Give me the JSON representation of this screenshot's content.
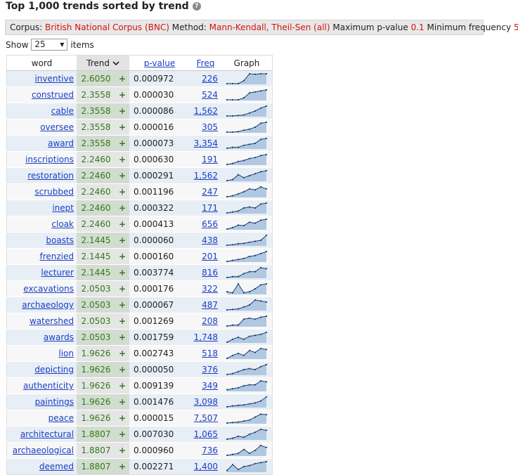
{
  "title": "Top 1,000 trends sorted by trend",
  "info": {
    "corpus_label": "Corpus:",
    "corpus_value": "British National Corpus (BNC)",
    "method_label": "Method:",
    "method_value": "Mann-Kendall, Theil-Sen (all)",
    "pvalue_label": "Maximum p-value",
    "pvalue_value": "0.1",
    "freq_label": "Minimum frequency",
    "freq_value": "5"
  },
  "show": {
    "label": "Show",
    "value": "25",
    "suffix": "items"
  },
  "columns": {
    "word": "word",
    "trend": "Trend",
    "pvalue": "p-value",
    "freq": "Freq",
    "graph": "Graph"
  },
  "colors": {
    "link": "#1a3ec5",
    "trend": "#2e7d1a",
    "accent": "#d21212",
    "graph_fill": "#b0c8e2",
    "graph_line": "#1d3f70"
  },
  "rows": [
    {
      "word": "inventive",
      "trend": "2.6050",
      "sign": "+",
      "pvalue": "0.000972",
      "freq": "226",
      "graph": [
        0,
        0,
        0,
        0.3,
        1,
        0.95,
        1,
        1
      ]
    },
    {
      "word": "construed",
      "trend": "2.3558",
      "sign": "+",
      "pvalue": "0.000030",
      "freq": "524",
      "graph": [
        0,
        0,
        0,
        0.2,
        0.7,
        0.8,
        0.9,
        1
      ]
    },
    {
      "word": "cable",
      "trend": "2.3558",
      "sign": "+",
      "pvalue": "0.000086",
      "freq": "1,562",
      "graph": [
        0,
        0,
        0.05,
        0.1,
        0.3,
        0.5,
        0.8,
        1
      ]
    },
    {
      "word": "oversee",
      "trend": "2.3558",
      "sign": "+",
      "pvalue": "0.000016",
      "freq": "305",
      "graph": [
        0,
        0,
        0.05,
        0.2,
        0.3,
        0.5,
        0.9,
        1
      ]
    },
    {
      "word": "award",
      "trend": "2.3558",
      "sign": "+",
      "pvalue": "0.000073",
      "freq": "3,354",
      "graph": [
        0,
        0.1,
        0.1,
        0.3,
        0.4,
        0.5,
        0.9,
        1
      ]
    },
    {
      "word": "inscriptions",
      "trend": "2.2460",
      "sign": "+",
      "pvalue": "0.000630",
      "freq": "191",
      "graph": [
        0,
        0.1,
        0.3,
        0.4,
        0.6,
        0.7,
        0.9,
        1
      ]
    },
    {
      "word": "restoration",
      "trend": "2.2460",
      "sign": "+",
      "pvalue": "0.000291",
      "freq": "1,562",
      "graph": [
        0,
        0.1,
        0.6,
        0.3,
        0.5,
        0.7,
        0.9,
        1
      ]
    },
    {
      "word": "scrubbed",
      "trend": "2.2460",
      "sign": "+",
      "pvalue": "0.001196",
      "freq": "247",
      "graph": [
        0,
        0.1,
        0.3,
        0.5,
        0.8,
        0.7,
        1,
        0.8
      ]
    },
    {
      "word": "inept",
      "trend": "2.2460",
      "sign": "+",
      "pvalue": "0.000322",
      "freq": "171",
      "graph": [
        0,
        0.1,
        0.2,
        0.5,
        0.6,
        0.5,
        0.9,
        1
      ]
    },
    {
      "word": "cloak",
      "trend": "2.2460",
      "sign": "+",
      "pvalue": "0.000413",
      "freq": "656",
      "graph": [
        0,
        0.15,
        0.4,
        0.35,
        0.7,
        0.6,
        0.9,
        1
      ]
    },
    {
      "word": "boasts",
      "trend": "2.1445",
      "sign": "+",
      "pvalue": "0.000060",
      "freq": "438",
      "graph": [
        0,
        0.05,
        0.15,
        0.2,
        0.3,
        0.4,
        0.5,
        1
      ]
    },
    {
      "word": "frenzied",
      "trend": "2.1445",
      "sign": "+",
      "pvalue": "0.000160",
      "freq": "201",
      "graph": [
        0,
        0.1,
        0.2,
        0.3,
        0.5,
        0.6,
        0.8,
        1
      ]
    },
    {
      "word": "lecturer",
      "trend": "2.1445",
      "sign": "+",
      "pvalue": "0.003774",
      "freq": "816",
      "graph": [
        0,
        0.1,
        0.1,
        0.4,
        0.6,
        0.6,
        1,
        0.9
      ]
    },
    {
      "word": "excavations",
      "trend": "2.0503",
      "sign": "+",
      "pvalue": "0.000176",
      "freq": "322",
      "graph": [
        0.2,
        0.1,
        1,
        0.1,
        0.2,
        0.5,
        0.9,
        1
      ]
    },
    {
      "word": "archaeology",
      "trend": "2.0503",
      "sign": "+",
      "pvalue": "0.000067",
      "freq": "487",
      "graph": [
        0,
        0.05,
        0.1,
        0.3,
        0.5,
        1,
        0.9,
        0.8
      ]
    },
    {
      "word": "watershed",
      "trend": "2.0503",
      "sign": "+",
      "pvalue": "0.001269",
      "freq": "208",
      "graph": [
        0,
        0.1,
        0.1,
        0.7,
        0.8,
        0.7,
        0.9,
        1
      ]
    },
    {
      "word": "awards",
      "trend": "2.0503",
      "sign": "+",
      "pvalue": "0.001759",
      "freq": "1,748",
      "graph": [
        0,
        0.3,
        0.5,
        0.3,
        0.6,
        0.7,
        0.8,
        1
      ]
    },
    {
      "word": "lion",
      "trend": "1.9626",
      "sign": "+",
      "pvalue": "0.002743",
      "freq": "518",
      "graph": [
        0,
        0.3,
        0.5,
        0.3,
        0.8,
        0.6,
        1,
        0.9
      ]
    },
    {
      "word": "depicting",
      "trend": "1.9626",
      "sign": "+",
      "pvalue": "0.000050",
      "freq": "376",
      "graph": [
        0,
        0.1,
        0.3,
        0.5,
        0.6,
        0.5,
        0.8,
        1
      ]
    },
    {
      "word": "authenticity",
      "trend": "1.9626",
      "sign": "+",
      "pvalue": "0.009139",
      "freq": "349",
      "graph": [
        0.1,
        0.2,
        0.3,
        0.5,
        0.6,
        0.6,
        1,
        0.9
      ]
    },
    {
      "word": "paintings",
      "trend": "1.9626",
      "sign": "+",
      "pvalue": "0.001476",
      "freq": "3,098",
      "graph": [
        0,
        0.1,
        0.15,
        0.2,
        0.3,
        0.4,
        0.6,
        1
      ]
    },
    {
      "word": "peace",
      "trend": "1.9626",
      "sign": "+",
      "pvalue": "0.000015",
      "freq": "7,507",
      "graph": [
        0,
        0.05,
        0.1,
        0.2,
        0.3,
        0.6,
        0.9,
        0.85
      ]
    },
    {
      "word": "architectural",
      "trend": "1.8807",
      "sign": "+",
      "pvalue": "0.007030",
      "freq": "1,065",
      "graph": [
        0,
        0.1,
        0.3,
        0.2,
        0.5,
        0.7,
        1,
        0.9
      ]
    },
    {
      "word": "archaeological",
      "trend": "1.8807",
      "sign": "+",
      "pvalue": "0.000960",
      "freq": "736",
      "graph": [
        0,
        0.1,
        0.2,
        0.6,
        0.2,
        0.5,
        1,
        0.8
      ]
    },
    {
      "word": "deemed",
      "trend": "1.8807",
      "sign": "+",
      "pvalue": "0.002271",
      "freq": "1,400",
      "graph": [
        0.1,
        0.7,
        0.2,
        0.5,
        0.6,
        0.8,
        0.9,
        1
      ]
    }
  ]
}
